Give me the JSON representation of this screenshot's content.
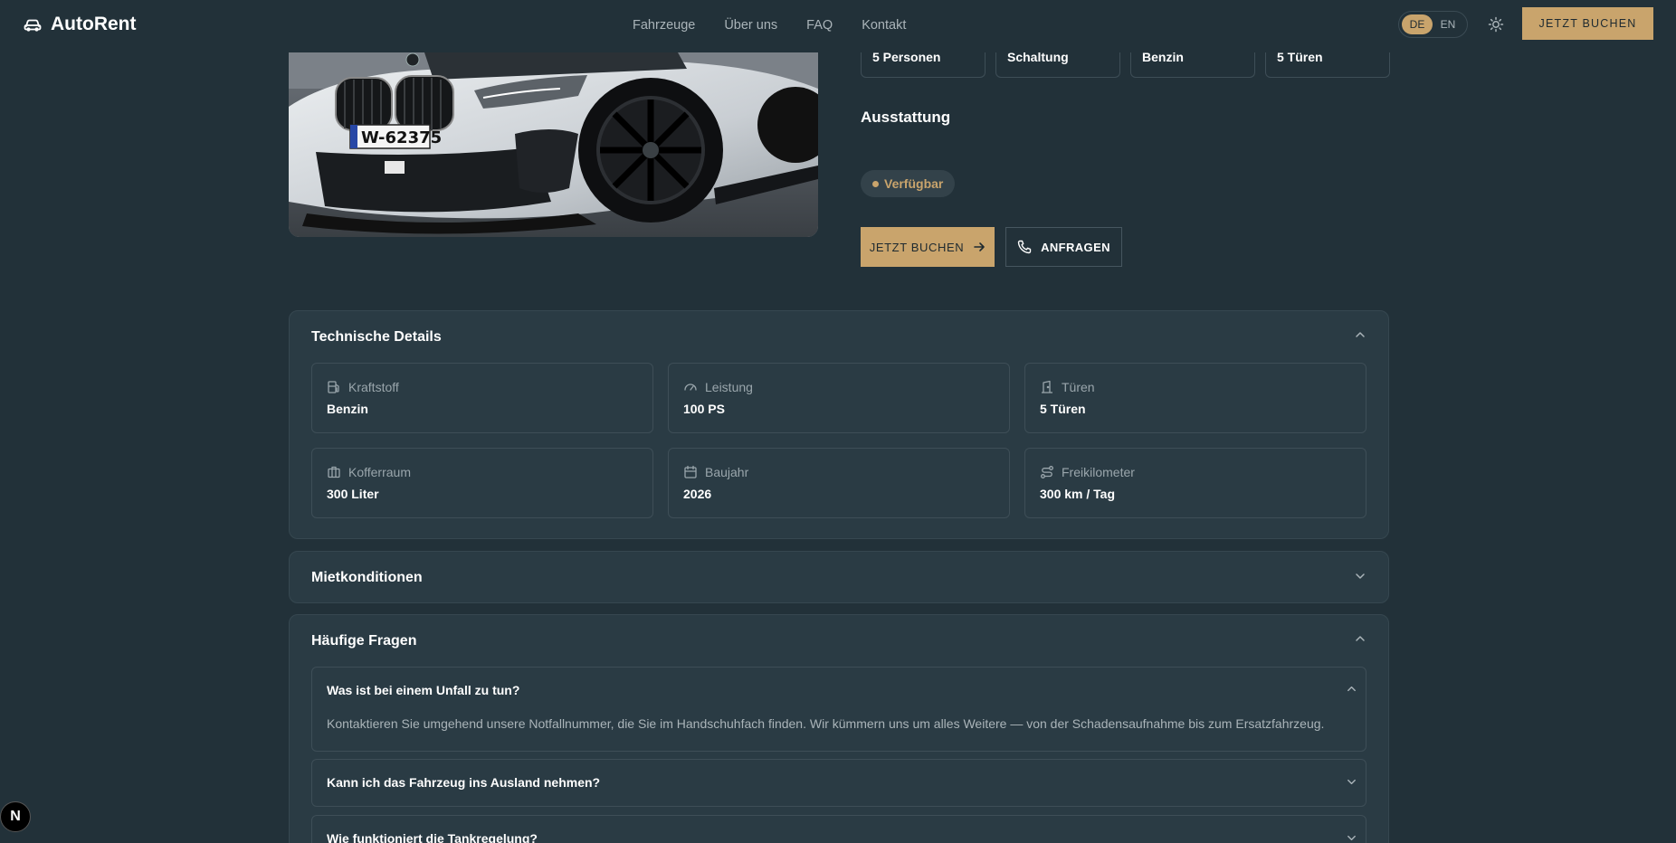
{
  "header": {
    "brand": "AutoRent",
    "nav": [
      "Fahrzeuge",
      "Über uns",
      "FAQ",
      "Kontakt"
    ],
    "lang": [
      "DE",
      "EN"
    ],
    "active_lang": "DE",
    "cta": "JETZT BUCHEN"
  },
  "car": {
    "plate": "W-62375"
  },
  "specs": [
    "5 Personen",
    "Schaltung",
    "Benzin",
    "5 Türen"
  ],
  "equipment_title": "Ausstattung",
  "status": "Verfügbar",
  "actions": {
    "book": "JETZT BUCHEN",
    "ask": "ANFRAGEN"
  },
  "technical": {
    "title": "Technische Details",
    "items": [
      {
        "label": "Kraftstoff",
        "value": "Benzin",
        "icon": "fuel-icon"
      },
      {
        "label": "Leistung",
        "value": "100 PS",
        "icon": "gauge-icon"
      },
      {
        "label": "Türen",
        "value": "5 Türen",
        "icon": "door-icon"
      },
      {
        "label": "Kofferraum",
        "value": "300 Liter",
        "icon": "luggage-icon"
      },
      {
        "label": "Baujahr",
        "value": "2026",
        "icon": "calendar-icon"
      },
      {
        "label": "Freikilometer",
        "value": "300 km / Tag",
        "icon": "route-icon"
      }
    ]
  },
  "rental": {
    "title": "Mietkonditionen"
  },
  "faq": {
    "title": "Häufige Fragen",
    "items": [
      {
        "q": "Was ist bei einem Unfall zu tun?",
        "a": "Kontaktieren Sie umgehend unsere Notfallnummer, die Sie im Handschuhfach finden. Wir kümmern uns um alles Weitere — von der Schadensaufnahme bis zum Ersatzfahrzeug.",
        "open": true
      },
      {
        "q": "Kann ich das Fahrzeug ins Ausland nehmen?",
        "open": false
      },
      {
        "q": "Wie funktioniert die Tankregelung?",
        "open": false
      }
    ]
  },
  "dev_badge": "N",
  "colors": {
    "background": "#223139",
    "panel": "#2a3b44",
    "accent": "#c9a46c",
    "border": "#3e4e57"
  }
}
